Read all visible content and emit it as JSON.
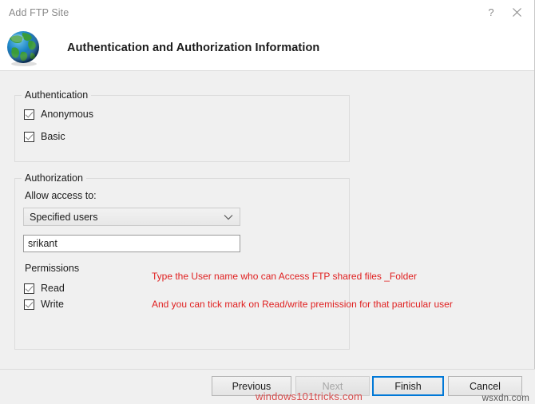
{
  "window": {
    "title": "Add FTP Site",
    "help_icon": "question-mark-icon",
    "close_icon": "close-icon"
  },
  "header": {
    "icon": "globe-icon",
    "title": "Authentication and Authorization Information"
  },
  "authentication": {
    "legend": "Authentication",
    "options": [
      {
        "label": "Anonymous",
        "checked": true
      },
      {
        "label": "Basic",
        "checked": true
      }
    ]
  },
  "authorization": {
    "legend": "Authorization",
    "allow_access_label": "Allow access to:",
    "mode_select": {
      "value": "Specified users",
      "arrow_icon": "chevron-down-icon"
    },
    "users_input": {
      "value": "srikant",
      "placeholder": ""
    },
    "permissions": {
      "legend": "Permissions",
      "options": [
        {
          "label": "Read",
          "checked": true
        },
        {
          "label": "Write",
          "checked": true
        }
      ]
    }
  },
  "annotations": [
    "Type the User name who can Access FTP shared files _Folder",
    "And you can tick mark on Read/write premission for that particular user"
  ],
  "footer": {
    "buttons": [
      {
        "label": "Previous",
        "state": "enabled"
      },
      {
        "label": "Next",
        "state": "disabled"
      },
      {
        "label": "Finish",
        "state": "default"
      },
      {
        "label": "Cancel",
        "state": "enabled"
      }
    ]
  },
  "watermarks": {
    "primary": "windows101tricks.com",
    "secondary": "wsxdn.com"
  },
  "colors": {
    "accent": "#0078d7",
    "annotation": "#e02020",
    "window_bg": "#f0f0f0",
    "watermark": "#d84b4b"
  }
}
